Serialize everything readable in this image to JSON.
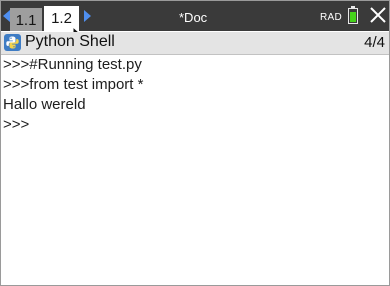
{
  "tabs": [
    {
      "label": "1.1",
      "active": false
    },
    {
      "label": "1.2",
      "active": true
    }
  ],
  "document": {
    "title": "*Doc",
    "angle_mode": "RAD",
    "battery_level": 0.85
  },
  "app": {
    "title": "Python Shell",
    "page_indicator": "4/4",
    "icon": "python-icon"
  },
  "console": {
    "lines": [
      ">>>#Running test.py",
      ">>>from test import *",
      "Hallo wereld",
      ">>>"
    ]
  },
  "colors": {
    "tab_bar": "#3a3a3a",
    "nav_arrow": "#4f8ff0",
    "battery": "#45d21a",
    "app_bar": "#e4e4e4"
  },
  "icons": [
    "nav-left-arrow-icon",
    "nav-right-arrow-icon",
    "battery-icon",
    "close-icon",
    "mouse-pointer-icon",
    "python-icon"
  ]
}
